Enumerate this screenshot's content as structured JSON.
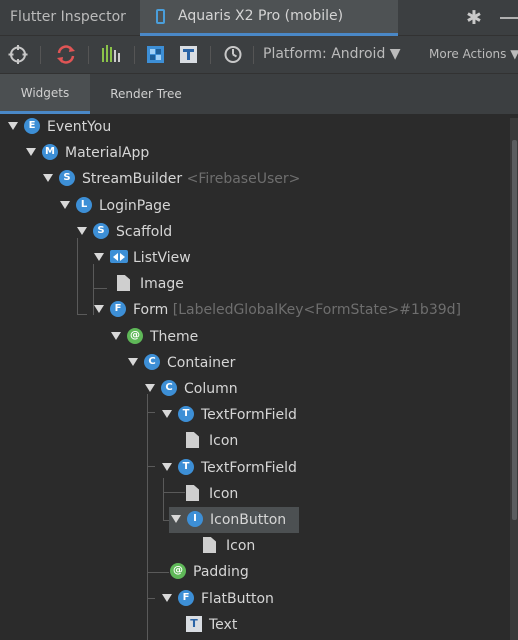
{
  "titlebar": {
    "title": "Flutter Inspector",
    "device_tab": "Aquaris X2 Pro (mobile)",
    "gear_glyph": "✱"
  },
  "toolbar": {
    "platform": "Platform: Android ▼",
    "more_actions": "More Actions ▼",
    "icons": [
      "select-widget-icon",
      "refresh-icon",
      "performance-icon",
      "debug-paint-icon",
      "text-icon",
      "slow-animations-icon"
    ]
  },
  "tabs": {
    "widgets": "Widgets",
    "render_tree": "Render Tree"
  },
  "colors": {
    "accent": "#4a88c7",
    "badge_blue": "#3d8fd6",
    "badge_green": "#5fb858",
    "selected_row": "#4c5052"
  },
  "tree": [
    {
      "name": "EventYou",
      "badge": "E",
      "extra": ""
    },
    {
      "name": "MaterialApp",
      "badge": "M",
      "extra": ""
    },
    {
      "name": "StreamBuilder",
      "badge": "S",
      "extra": "<FirebaseUser>"
    },
    {
      "name": "LoginPage",
      "badge": "L",
      "extra": ""
    },
    {
      "name": "Scaffold",
      "badge": "S",
      "extra": ""
    },
    {
      "name": "ListView",
      "badge": "",
      "extra": ""
    },
    {
      "name": "Image",
      "badge": "",
      "extra": ""
    },
    {
      "name": "Form",
      "badge": "F",
      "extra": "[LabeledGlobalKey<FormState>#1b39d]"
    },
    {
      "name": "Theme",
      "badge": "@",
      "extra": ""
    },
    {
      "name": "Container",
      "badge": "C",
      "extra": ""
    },
    {
      "name": "Column",
      "badge": "C",
      "extra": ""
    },
    {
      "name": "TextFormField",
      "badge": "T",
      "extra": ""
    },
    {
      "name": "Icon",
      "badge": "",
      "extra": ""
    },
    {
      "name": "TextFormField",
      "badge": "T",
      "extra": ""
    },
    {
      "name": "Icon",
      "badge": "",
      "extra": ""
    },
    {
      "name": "IconButton",
      "badge": "I",
      "extra": ""
    },
    {
      "name": "Icon",
      "badge": "",
      "extra": ""
    },
    {
      "name": "Padding",
      "badge": "@",
      "extra": ""
    },
    {
      "name": "FlatButton",
      "badge": "F",
      "extra": ""
    },
    {
      "name": "Text",
      "badge": "T",
      "extra": ""
    }
  ]
}
